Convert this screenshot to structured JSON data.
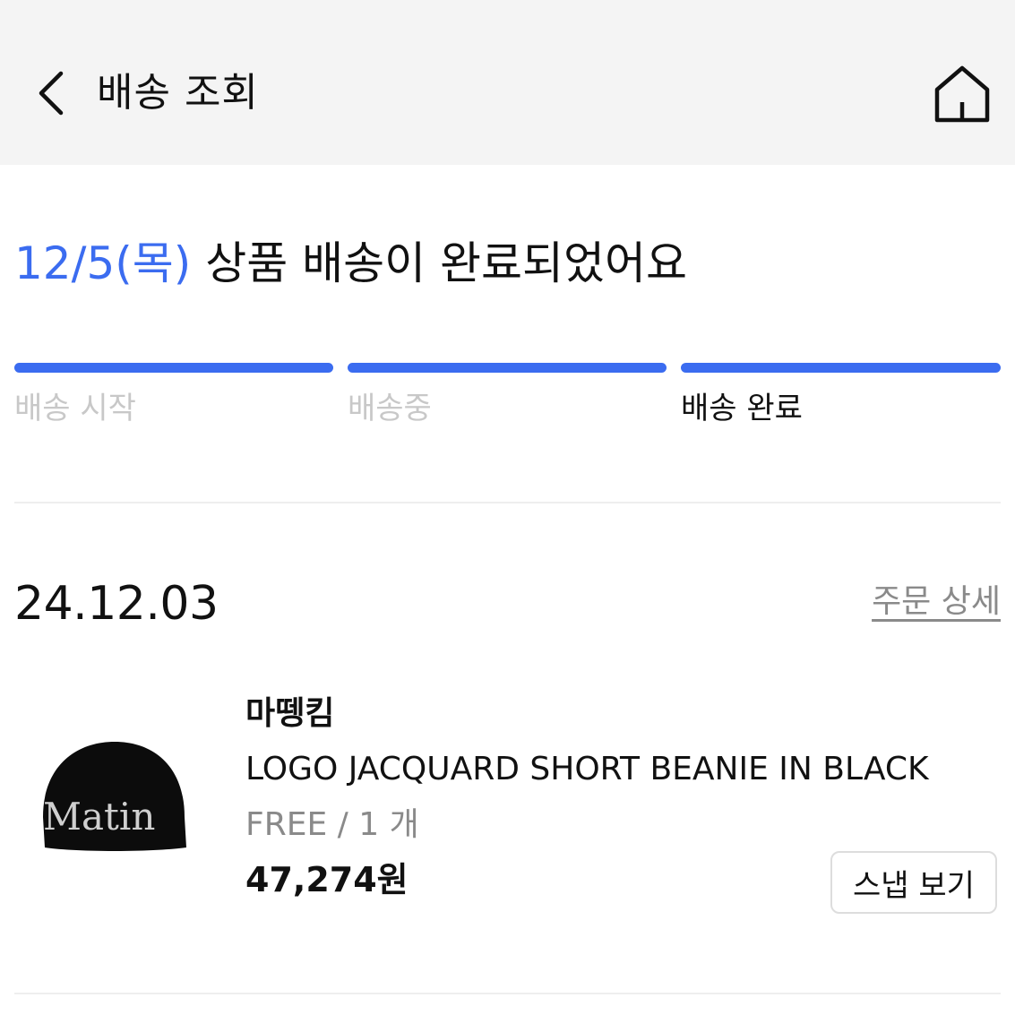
{
  "header": {
    "title": "배송 조회",
    "back_icon": "chevron-left-icon",
    "home_icon": "home-icon"
  },
  "status": {
    "date": "12/5(목)",
    "message": "상품 배송이 완료되었어요",
    "accent_color": "#3b6cf0"
  },
  "progress": {
    "steps": [
      {
        "label": "배송 시작",
        "done": true,
        "current": false
      },
      {
        "label": "배송중",
        "done": true,
        "current": false
      },
      {
        "label": "배송 완료",
        "done": true,
        "current": true
      }
    ]
  },
  "order": {
    "date": "24.12.03",
    "detail_link": "주문 상세",
    "item": {
      "brand": "마뗑킴",
      "name": "LOGO JACQUARD SHORT BEANIE IN BLACK",
      "option": "FREE / 1 개",
      "price": "47,274원",
      "image_text": "Matin",
      "snap_button": "스냅 보기"
    }
  }
}
